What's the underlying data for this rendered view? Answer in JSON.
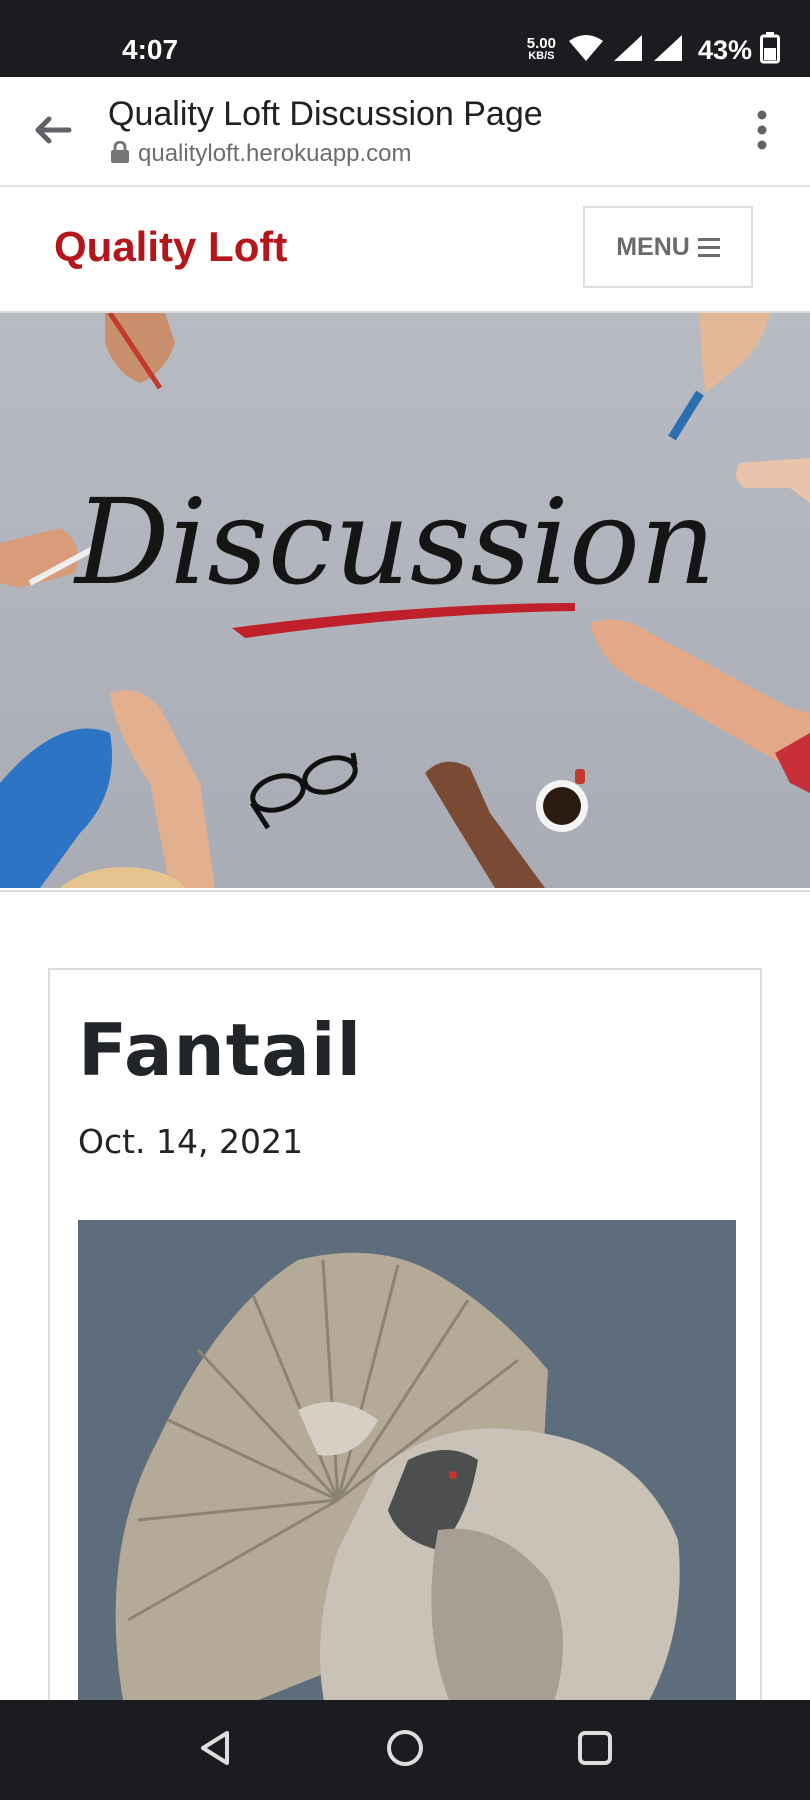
{
  "status_bar": {
    "time": "4:07",
    "net_speed_value": "5.00",
    "net_speed_unit": "KB/S",
    "battery_percent": "43%"
  },
  "browser": {
    "page_title": "Quality Loft Discussion Page",
    "url": "qualityloft.herokuapp.com"
  },
  "site": {
    "brand": "Quality Loft",
    "menu_label": "MENU",
    "accent_color": "#b4161b"
  },
  "hero": {
    "heading_text": "Discussion"
  },
  "post": {
    "title": "Fantail",
    "date": "Oct. 14, 2021"
  },
  "icons": {
    "back": "arrow-left-icon",
    "more": "more-vert-icon",
    "lock": "lock-icon",
    "wifi": "wifi-icon",
    "signal": "signal-icon",
    "battery": "battery-icon",
    "nav_back": "triangle-back-icon",
    "nav_home": "circle-home-icon",
    "nav_recents": "square-recents-icon"
  }
}
